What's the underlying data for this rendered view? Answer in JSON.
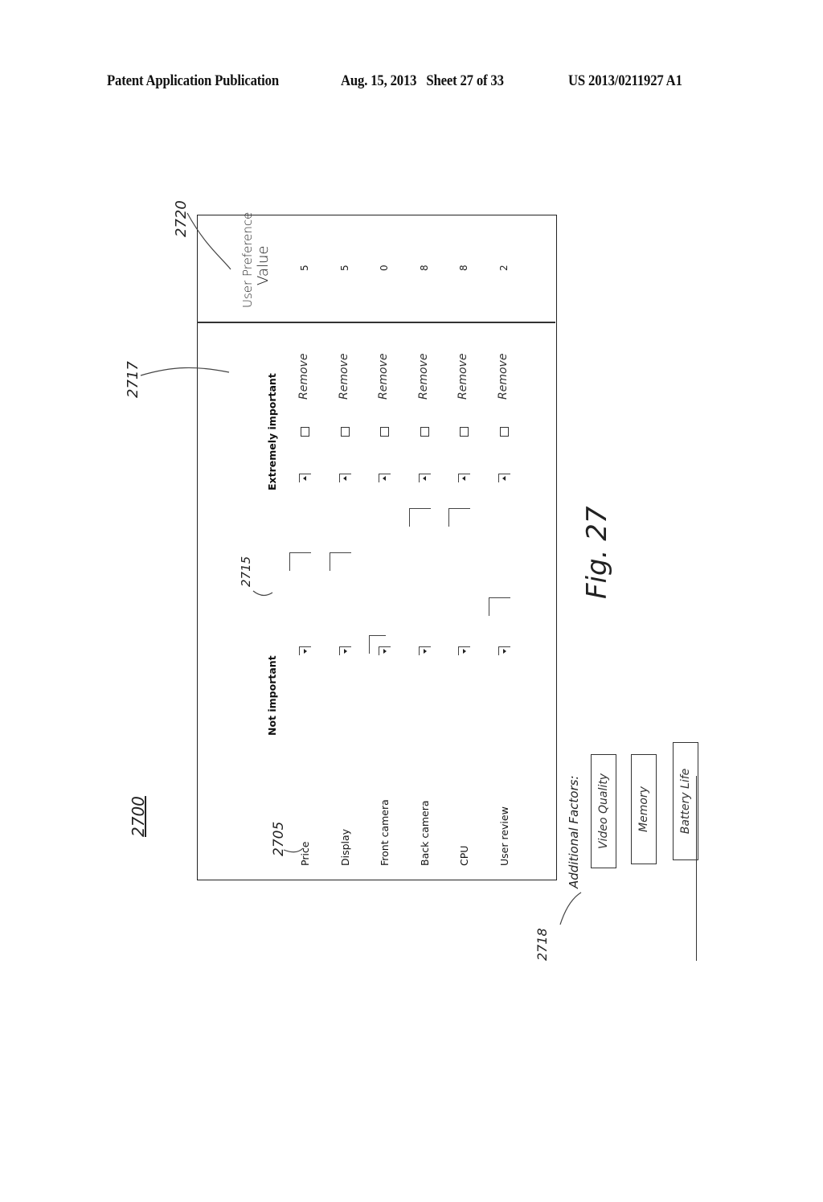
{
  "header": {
    "publication": "Patent Application Publication",
    "date_sheet": "Aug. 15, 2013   Sheet 27 of 33",
    "number": "US 2013/0211927 A1"
  },
  "figure": {
    "label": "Fig. 27",
    "ref_main": "2700",
    "ref_rows": "2705",
    "ref_sliders": "2715",
    "ref_remove": "2717",
    "ref_factors": "2718",
    "ref_values": "2720"
  },
  "table": {
    "col_not_important": "Not important",
    "col_extremely_important": "Extremely important",
    "col_value": "User Preference Value",
    "value_header_line1": "User Preference",
    "value_header_line2": "Value",
    "remove_label": "Remove",
    "rows": [
      {
        "label": "Price",
        "slider_fraction": 0.5,
        "value": "5"
      },
      {
        "label": "Display",
        "slider_fraction": 0.5,
        "value": "5"
      },
      {
        "label": "Front camera",
        "slider_fraction": 0.0,
        "value": "0"
      },
      {
        "label": "Back camera",
        "slider_fraction": 0.8,
        "value": "8"
      },
      {
        "label": "CPU",
        "slider_fraction": 0.8,
        "value": "8"
      },
      {
        "label": "User review",
        "slider_fraction": 0.2,
        "value": "2"
      }
    ]
  },
  "additional_factors": {
    "title": "Additional Factors:",
    "items": [
      "Video Quality",
      "Memory",
      "Battery Life"
    ]
  }
}
